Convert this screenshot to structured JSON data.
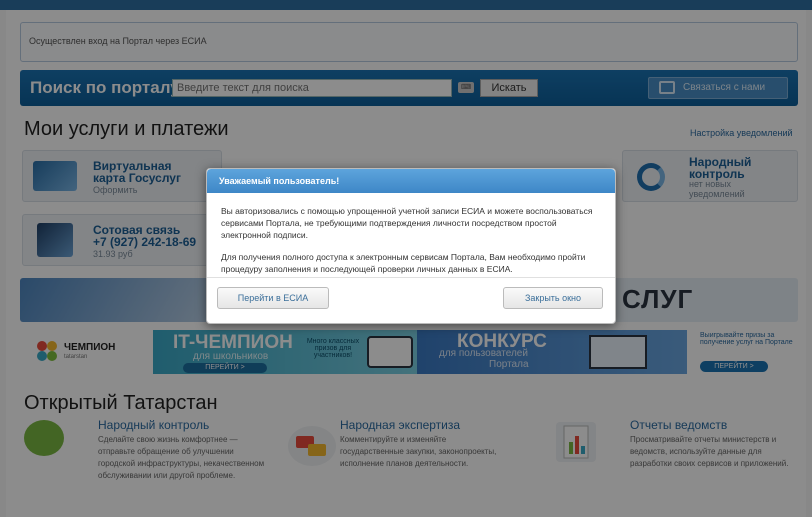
{
  "notice": {
    "text": "Осуществлен вход на Портал через ЕСИА"
  },
  "search": {
    "title": "Поиск по порталу:",
    "placeholder": "Введите текст для поиска",
    "button": "Искать",
    "contact": "Связаться с нами"
  },
  "services": {
    "title": "Мои услуги и платежи",
    "notify_settings": "Настройка уведомлений",
    "cards": [
      {
        "title1": "Виртуальная",
        "title2": "карта Госуслуг",
        "sub": "Оформить"
      },
      {
        "title1": "Сотовая связь",
        "title2": "+7 (927) 242-18-69",
        "sub": "31.93 руб"
      },
      {
        "title1": "Народный",
        "title2": "контроль",
        "sub1": "нет новых",
        "sub2": "уведомлений"
      }
    ],
    "banner_text": "СЛУГ"
  },
  "promo": {
    "champion_name": "ЧЕМПИОН",
    "champion_sub": "tatarstan",
    "it_title": "IT-ЧЕМПИОН",
    "it_sub": "для школьников",
    "it_button": "ПЕРЕЙТИ >",
    "it_note": "Много классных призов для участников!",
    "konk_title": "КОНКУРС",
    "konk_sub": "для пользователей",
    "konk_sub2": "Портала",
    "prize_text": "Выигрывайте призы за получение услуг на Портале",
    "prize_button": "ПЕРЕЙТИ >"
  },
  "open": {
    "title": "Открытый Татарстан",
    "items": [
      {
        "title": "Народный контроль",
        "desc": "Сделайте свою жизнь комфортнее — отправьте обращение об улучшении городской инфраструктуры, некачественном обслуживании или другой проблеме."
      },
      {
        "title": "Народная экспертиза",
        "desc": "Комментируйте и изменяйте государственные закупки, законопроекты, исполнение планов деятельности."
      },
      {
        "title": "Отчеты ведомств",
        "desc": "Просматривайте отчеты министерств и ведомств, используйте данные для разработки своих сервисов и приложений."
      }
    ]
  },
  "modal": {
    "title": "Уважаемый пользователь!",
    "p1": "Вы авторизовались с помощью упрощенной учетной записи ЕСИА и можете воспользоваться сервисами Портала, не требующими подтверждения личности посредством простой электронной подписи.",
    "p2": "Для получения полного доступа к электронным сервисам Портала, Вам необходимо пройти процедуру заполнения и последующей проверки личных данных в ЕСИА.",
    "btn_esia": "Перейти в ЕСИА",
    "btn_close": "Закрыть окно"
  },
  "colors": {
    "brand": "#1a73b3",
    "link": "#2a6aa0",
    "modal_head": "#4a93d0"
  },
  "icons": [
    "keyboard-icon",
    "contact-icon",
    "map-pin-icon",
    "chat-icon",
    "report-icon"
  ]
}
